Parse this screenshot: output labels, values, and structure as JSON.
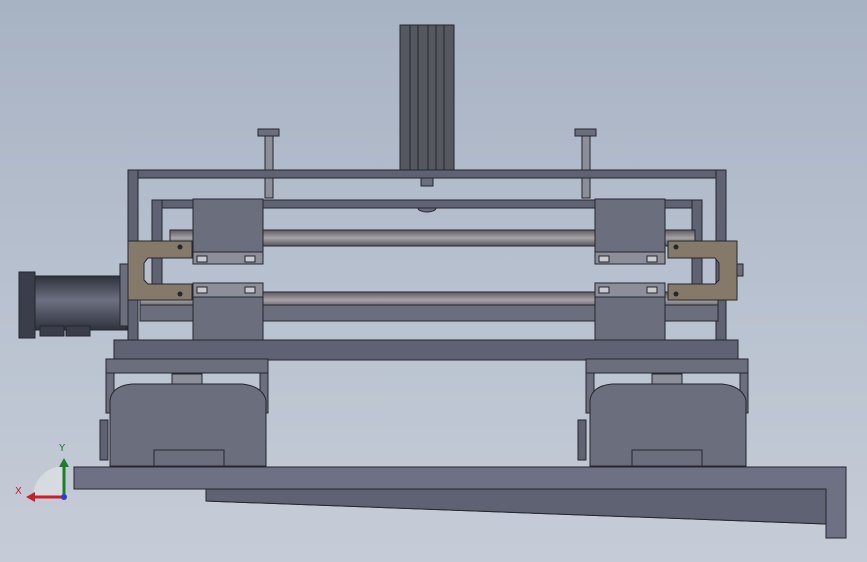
{
  "viewport": {
    "background_top": "#a7b2c3",
    "background_bottom": "#c6ccd7"
  },
  "model": {
    "colors": {
      "body": "#5f6272",
      "body_dark": "#4a4d5c",
      "outline": "#25262e",
      "block": "#6b6e7c",
      "bracket": "#85796a",
      "cylinder": "#7f7d80",
      "motor": "#3f4350",
      "tower": "#55585f",
      "base": "#6e7183",
      "light_part": "#8c8f99"
    },
    "parts": [
      "tower-column",
      "rod-left",
      "rod-right",
      "upper-frame",
      "shaft-upper",
      "shaft-lower",
      "slider-block-left",
      "slider-block-right",
      "bracket-left",
      "bracket-right",
      "servo-motor",
      "lower-plate",
      "caster-housing-left",
      "caster-housing-right",
      "base-rail"
    ]
  },
  "triad": {
    "x_label": "X",
    "y_label": "Y",
    "x_color": "#c8202a",
    "y_color": "#1d7d2a",
    "z_color": "#2d3bd0"
  }
}
